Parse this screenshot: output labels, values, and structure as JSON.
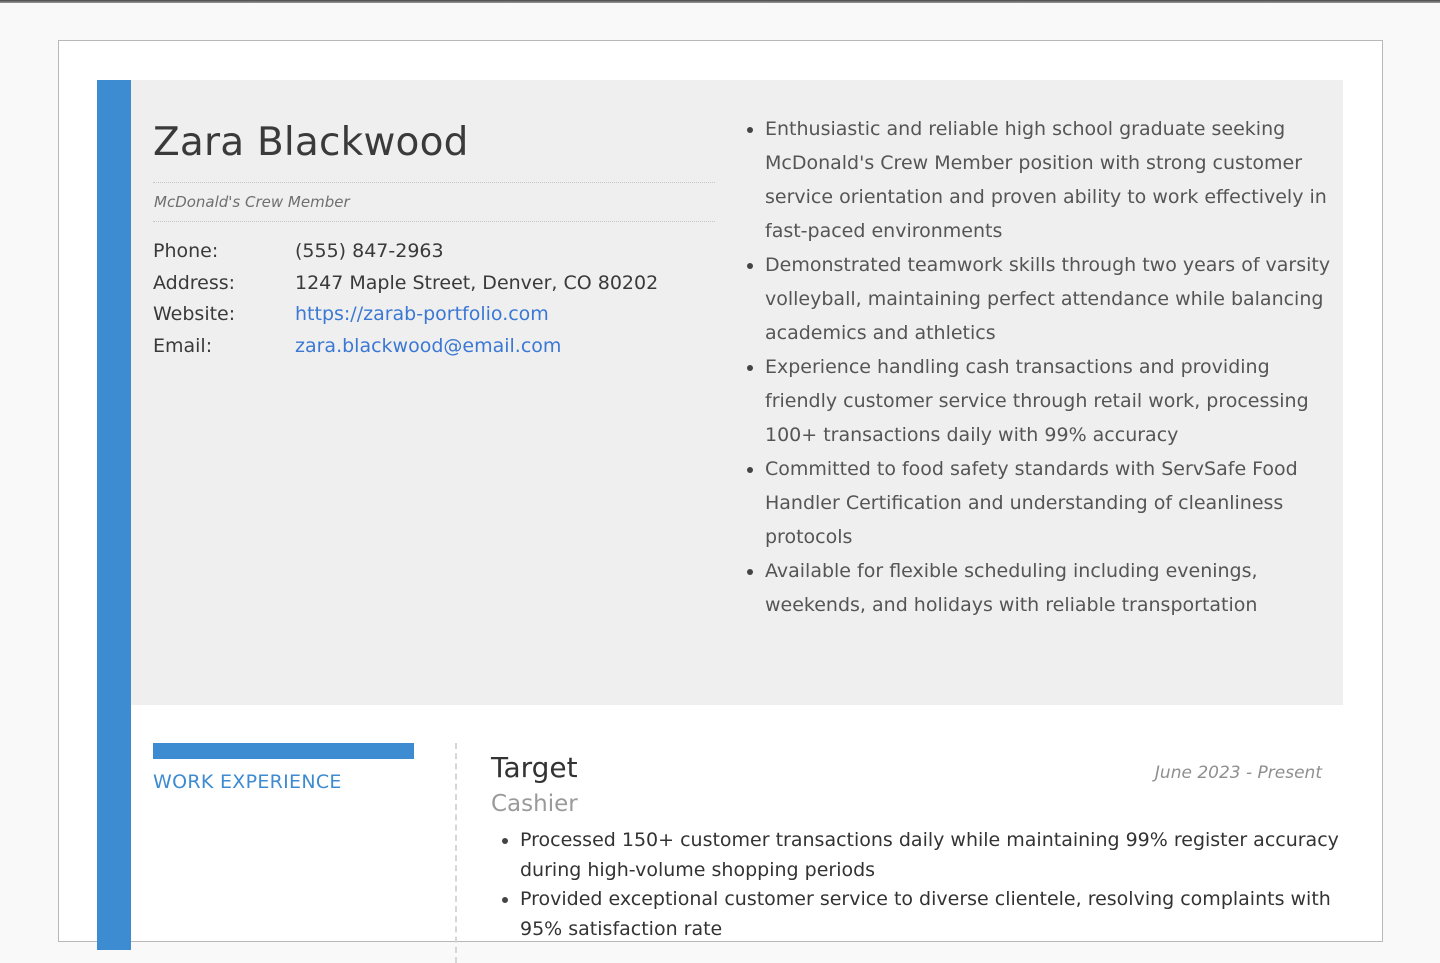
{
  "resume": {
    "name": "Zara Blackwood",
    "title": "McDonald's Crew Member",
    "contact": [
      {
        "label": "Phone:",
        "value": "(555) 847-2963",
        "link": false
      },
      {
        "label": "Address:",
        "value": "1247 Maple Street, Denver, CO 80202",
        "link": false
      },
      {
        "label": "Website:",
        "value": "https://zarab-portfolio.com",
        "link": true
      },
      {
        "label": "Email:",
        "value": "zara.blackwood@email.com",
        "link": true
      }
    ],
    "summary": [
      "Enthusiastic and reliable high school graduate seeking McDonald's Crew Member position with strong customer service orientation and proven ability to work effectively in fast-paced environments",
      "Demonstrated teamwork skills through two years of varsity volleyball, maintaining perfect attendance while balancing academics and athletics",
      "Experience handling cash transactions and providing friendly customer service through retail work, processing 100+ transactions daily with 99% accuracy",
      "Committed to food safety standards with ServSafe Food Handler Certification and understanding of cleanliness protocols",
      "Available for flexible scheduling including evenings, weekends, and holidays with reliable transportation"
    ]
  },
  "work_experience": {
    "heading": "WORK EXPERIENCE",
    "jobs": [
      {
        "employer": "Target",
        "role": "Cashier",
        "dates": "June 2023 - Present",
        "duties": [
          "Processed 150+ customer transactions daily while maintaining 99% register accuracy during high-volume shopping periods",
          "Provided exceptional customer service to diverse clientele, resolving complaints with 95% satisfaction rate"
        ]
      }
    ]
  },
  "colors": {
    "accent": "#3d8bd0",
    "link": "#3a78d4",
    "header_bg": "#efefef"
  }
}
